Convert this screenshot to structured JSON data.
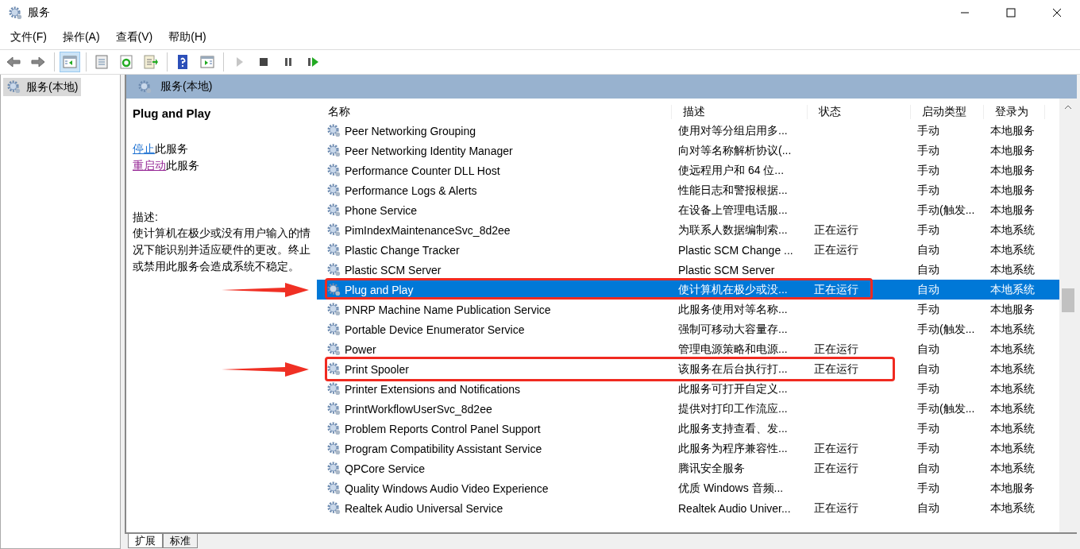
{
  "window": {
    "title": "服务"
  },
  "menu": [
    "文件(F)",
    "操作(A)",
    "查看(V)",
    "帮助(H)"
  ],
  "toolbar": [
    {
      "kind": "back",
      "disabled": false,
      "pressed": false
    },
    {
      "kind": "forward",
      "disabled": false,
      "pressed": false
    },
    {
      "kind": "tree",
      "disabled": false,
      "pressed": true
    },
    {
      "kind": "properties",
      "disabled": false,
      "pressed": false
    },
    {
      "kind": "refresh",
      "disabled": false,
      "pressed": false
    },
    {
      "kind": "export",
      "disabled": false,
      "pressed": false
    },
    {
      "kind": "help",
      "disabled": false,
      "pressed": false
    },
    {
      "kind": "actionpane",
      "disabled": false,
      "pressed": false
    },
    {
      "kind": "play",
      "disabled": true,
      "pressed": false
    },
    {
      "kind": "stop",
      "disabled": false,
      "pressed": false
    },
    {
      "kind": "pause",
      "disabled": false,
      "pressed": false
    },
    {
      "kind": "resume",
      "disabled": false,
      "pressed": false
    }
  ],
  "tree": {
    "items": [
      {
        "label": "服务(本地)",
        "selected": true
      }
    ]
  },
  "panel": {
    "title": "服务(本地)"
  },
  "detail": {
    "service_name": "Plug and Play",
    "actions": [
      {
        "link": "停止",
        "text": "此服务",
        "visited": false
      },
      {
        "link": "重启动",
        "text": "此服务",
        "visited": true
      }
    ],
    "description_label": "描述:",
    "description": "使计算机在极少或没有用户输入的情况下能识别并适应硬件的更改。终止或禁用此服务会造成系统不稳定。"
  },
  "table": {
    "columns": [
      "名称",
      "描述",
      "状态",
      "启动类型",
      "登录为"
    ],
    "rows": [
      {
        "name": "Peer Networking Grouping",
        "description": "使用对等分组启用多...",
        "status": "",
        "startup": "手动",
        "logon": "本地服务",
        "selected": false,
        "marked": false
      },
      {
        "name": "Peer Networking Identity Manager",
        "description": "向对等名称解析协议(...",
        "status": "",
        "startup": "手动",
        "logon": "本地服务",
        "selected": false,
        "marked": false
      },
      {
        "name": "Performance Counter DLL Host",
        "description": "使远程用户和 64 位...",
        "status": "",
        "startup": "手动",
        "logon": "本地服务",
        "selected": false,
        "marked": false
      },
      {
        "name": "Performance Logs & Alerts",
        "description": "性能日志和警报根据...",
        "status": "",
        "startup": "手动",
        "logon": "本地服务",
        "selected": false,
        "marked": false
      },
      {
        "name": "Phone Service",
        "description": "在设备上管理电话服...",
        "status": "",
        "startup": "手动(触发...",
        "logon": "本地服务",
        "selected": false,
        "marked": false
      },
      {
        "name": "PimIndexMaintenanceSvc_8d2ee",
        "description": "为联系人数据编制索...",
        "status": "正在运行",
        "startup": "手动",
        "logon": "本地系统",
        "selected": false,
        "marked": false
      },
      {
        "name": "Plastic Change Tracker",
        "description": "Plastic SCM Change ...",
        "status": "正在运行",
        "startup": "自动",
        "logon": "本地系统",
        "selected": false,
        "marked": false
      },
      {
        "name": "Plastic SCM Server",
        "description": "Plastic SCM Server",
        "status": "",
        "startup": "自动",
        "logon": "本地系统",
        "selected": false,
        "marked": false
      },
      {
        "name": "Plug and Play",
        "description": "使计算机在极少或没...",
        "status": "正在运行",
        "startup": "自动",
        "logon": "本地系统",
        "selected": true,
        "marked": true
      },
      {
        "name": "PNRP Machine Name Publication Service",
        "description": "此服务使用对等名称...",
        "status": "",
        "startup": "手动",
        "logon": "本地服务",
        "selected": false,
        "marked": false
      },
      {
        "name": "Portable Device Enumerator Service",
        "description": "强制可移动大容量存...",
        "status": "",
        "startup": "手动(触发...",
        "logon": "本地系统",
        "selected": false,
        "marked": false
      },
      {
        "name": "Power",
        "description": "管理电源策略和电源...",
        "status": "正在运行",
        "startup": "自动",
        "logon": "本地系统",
        "selected": false,
        "marked": false
      },
      {
        "name": "Print Spooler",
        "description": "该服务在后台执行打...",
        "status": "正在运行",
        "startup": "自动",
        "logon": "本地系统",
        "selected": false,
        "marked": true
      },
      {
        "name": "Printer Extensions and Notifications",
        "description": "此服务可打开自定义...",
        "status": "",
        "startup": "手动",
        "logon": "本地系统",
        "selected": false,
        "marked": false
      },
      {
        "name": "PrintWorkflowUserSvc_8d2ee",
        "description": "提供对打印工作流应...",
        "status": "",
        "startup": "手动(触发...",
        "logon": "本地系统",
        "selected": false,
        "marked": false
      },
      {
        "name": "Problem Reports Control Panel Support",
        "description": "此服务支持查看、发...",
        "status": "",
        "startup": "手动",
        "logon": "本地系统",
        "selected": false,
        "marked": false
      },
      {
        "name": "Program Compatibility Assistant Service",
        "description": "此服务为程序兼容性...",
        "status": "正在运行",
        "startup": "手动",
        "logon": "本地系统",
        "selected": false,
        "marked": false
      },
      {
        "name": "QPCore Service",
        "description": "腾讯安全服务",
        "status": "正在运行",
        "startup": "自动",
        "logon": "本地系统",
        "selected": false,
        "marked": false
      },
      {
        "name": "Quality Windows Audio Video Experience",
        "description": "优质 Windows 音频...",
        "status": "",
        "startup": "手动",
        "logon": "本地服务",
        "selected": false,
        "marked": false
      },
      {
        "name": "Realtek Audio Universal Service",
        "description": "Realtek Audio Univer...",
        "status": "正在运行",
        "startup": "自动",
        "logon": "本地系统",
        "selected": false,
        "marked": false
      }
    ]
  },
  "bottom_tabs": [
    {
      "label": "扩展",
      "selected": true
    },
    {
      "label": "标准",
      "selected": false
    }
  ]
}
